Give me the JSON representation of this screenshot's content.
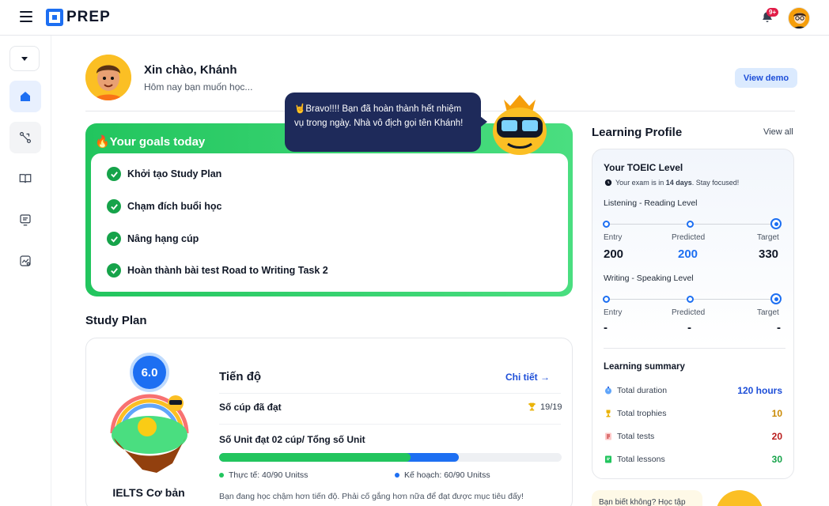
{
  "app": {
    "logo_text": "PREP",
    "notifications_badge": "9+"
  },
  "header": {
    "greeting": "Xin chào, Khánh",
    "subtitle": "Hôm nay bạn muốn học...",
    "view_demo": "View demo"
  },
  "goals": {
    "title": "🔥Your goals today",
    "items": [
      {
        "label": "Khởi tạo Study Plan"
      },
      {
        "label": "Chạm đích buổi học"
      },
      {
        "label": "Nâng hạng cúp"
      },
      {
        "label": "Hoàn thành bài test Road to Writing Task 2"
      }
    ],
    "bubble": "🤘Bravo!!!! Bạn đã hoàn thành hết nhiệm vụ trong ngày. Nhà vô địch gọi tên Khánh!"
  },
  "study_plan": {
    "title": "Study Plan",
    "score": "6.0",
    "course_name": "IELTS Cơ bản",
    "progress_title": "Tiến độ",
    "detail_link": "Chi tiết",
    "cups_label": "Số cúp đã đạt",
    "cups_value": "19/19",
    "units_label": "Số Unit đạt 02 cúp/ Tổng số Unit",
    "actual_legend": "Thực tế: 40/90 Unitss",
    "plan_legend": "Kế hoạch: 60/90 Unitss",
    "actual_fraction": 0.56,
    "plan_fraction": 0.7,
    "note": "Bạn đang học chậm hơn tiến độ. Phải cố gắng hơn nữa để đạt được mục tiêu đấy!",
    "colors": {
      "actual": "#22c55e",
      "plan": "#1d6ff2"
    }
  },
  "learning_profile": {
    "title": "Learning Profile",
    "view_all": "View all",
    "level_title": "Your TOEIC Level",
    "exam_prefix": "Your exam is in ",
    "exam_days": "14 days",
    "exam_suffix": ". Stay focused!",
    "listening_reading": {
      "label": "Listening - Reading Level",
      "entry_label": "Entry",
      "predicted_label": "Predicted",
      "target_label": "Target",
      "entry": "200",
      "predicted": "200",
      "target": "330"
    },
    "writing_speaking": {
      "label": "Writing - Speaking Level",
      "entry_label": "Entry",
      "predicted_label": "Predicted",
      "target_label": "Target",
      "entry": "-",
      "predicted": "-",
      "target": "-"
    },
    "summary": {
      "title": "Learning summary",
      "rows": [
        {
          "label": "Total duration",
          "value": "120 hours",
          "color": "#1d4ed8",
          "icon": "stopwatch-icon"
        },
        {
          "label": "Total trophies",
          "value": "10",
          "color": "#ca8a04",
          "icon": "trophy-icon"
        },
        {
          "label": "Total tests",
          "value": "20",
          "color": "#b91c1c",
          "icon": "test-icon"
        },
        {
          "label": "Total lessons",
          "value": "30",
          "color": "#16a34a",
          "icon": "lesson-icon"
        }
      ]
    },
    "tip": "Bạn biết không? Học tập"
  }
}
